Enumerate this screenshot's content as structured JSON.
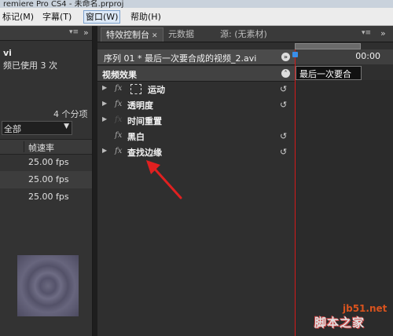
{
  "window_title_fragment": "remiere Pro CS4 - 未命名.prproj",
  "menu": [
    "标记(M)",
    "字幕(T)",
    "窗口(W)",
    "帮助(H)"
  ],
  "left_panel": {
    "file_ext": "vi",
    "usage_text": "频已使用 3 次",
    "items_count": "4 个分项",
    "filter_value": "全部",
    "column_header": "帧速率",
    "rows": [
      "25.00 fps",
      "25.00 fps",
      "25.00 fps"
    ]
  },
  "tabs": [
    {
      "label": "特效控制台",
      "active": true
    },
    {
      "label": "元数据",
      "active": false
    },
    {
      "label": "源: (无素材)",
      "active": false
    }
  ],
  "effect_controls": {
    "sequence_label": "序列 01 * 最后一次要合成的视频_2.avi",
    "video_effects_header": "视频效果",
    "effects": [
      {
        "name": "运动",
        "has_twirl": true,
        "has_fx": true,
        "icon": "motion-icon"
      },
      {
        "name": "透明度",
        "has_twirl": true,
        "has_fx": true
      },
      {
        "name": "时间重置",
        "has_twirl": true,
        "has_fx": false
      },
      {
        "name": "黑白",
        "has_twirl": false,
        "has_fx": true
      },
      {
        "name": "查找边缘",
        "has_twirl": true,
        "has_fx": true
      }
    ]
  },
  "timeline": {
    "timecode": "00:00",
    "clip_label": "最后一次要合"
  },
  "watermark": {
    "site": "jb51.net",
    "name": "脚本之家"
  },
  "colors": {
    "playhead": "#d41a1a",
    "annotation_arrow": "#e02020"
  }
}
